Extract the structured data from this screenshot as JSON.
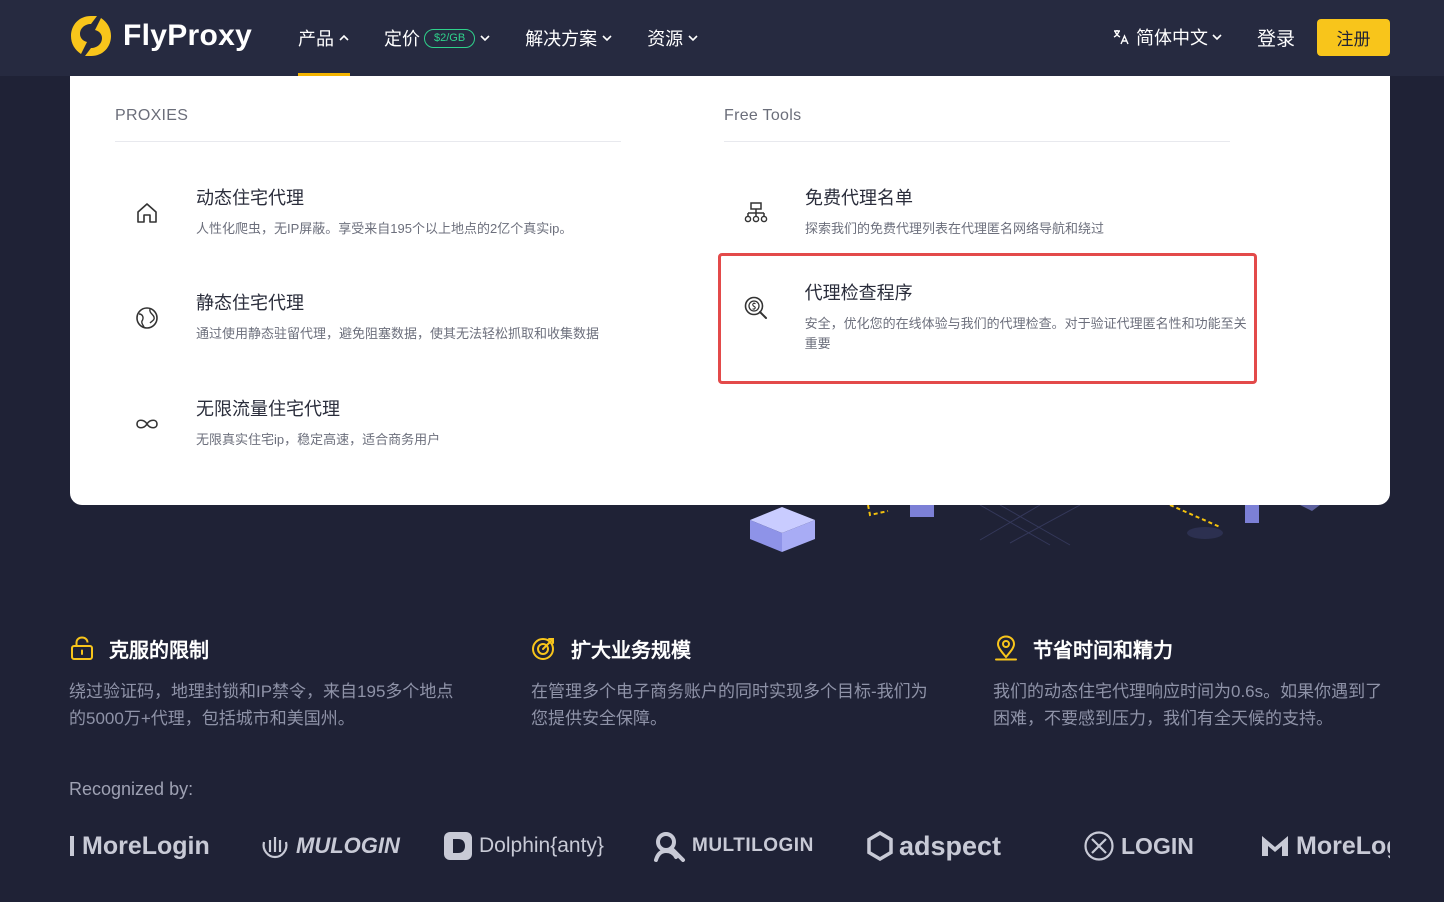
{
  "header": {
    "brand": "FlyProxy",
    "nav": [
      {
        "label": "产品"
      },
      {
        "label": "定价",
        "badge": "$2/GB"
      },
      {
        "label": "解决方案"
      },
      {
        "label": "资源"
      }
    ],
    "language": "简体中文",
    "login": "登录",
    "signup": "注册"
  },
  "dropdown": {
    "proxies": {
      "heading": "PROXIES",
      "items": [
        {
          "title": "动态住宅代理",
          "desc": "人性化爬虫，无IP屏蔽。享受来自195个以上地点的2亿个真实ip。",
          "icon": "home-icon"
        },
        {
          "title": "静态住宅代理",
          "desc": "通过使用静态驻留代理，避免阻塞数据，使其无法轻松抓取和收集数据",
          "icon": "globe-icon"
        },
        {
          "title": "无限流量住宅代理",
          "desc": "无限真实住宅ip，稳定高速，适合商务用户",
          "icon": "infinity-icon"
        }
      ]
    },
    "tools": {
      "heading": "Free Tools",
      "items": [
        {
          "title": "免费代理名单",
          "desc": "探索我们的免费代理列表在代理匿名网络导航和绕过",
          "icon": "network-icon"
        },
        {
          "title": "代理检查程序",
          "desc": "安全，优化您的在线体验与我们的代理检查。对于验证代理匿名性和功能至关重要",
          "icon": "proxy-checker-icon"
        }
      ]
    }
  },
  "features": [
    {
      "title": "克服的限制",
      "desc": "绕过验证码，地理封锁和IP禁令，来自195多个地点的5000万+代理，包括城市和美国州。",
      "icon": "lock-icon"
    },
    {
      "title": "扩大业务规模",
      "desc": "在管理多个电子商务账户的同时实现多个目标-我们为您提供安全保障。",
      "icon": "target-icon"
    },
    {
      "title": "节省时间和精力",
      "desc": "我们的动态住宅代理响应时间为0.6s。如果你遇到了困难，不要感到压力，我们有全天候的支持。",
      "icon": "location-pin-icon"
    }
  ],
  "recognized": {
    "label": "Recognized by:",
    "brands": [
      "MoreLogin",
      "MULOGIN",
      "Dolphin{anty}",
      "MULTILOGIN",
      "adspect",
      "LOGIN",
      "MoreLogin"
    ]
  },
  "colors": {
    "background": "#1f2236",
    "accent": "#f8c51b",
    "badge": "#2fd18b",
    "highlight": "#e34a4a"
  }
}
